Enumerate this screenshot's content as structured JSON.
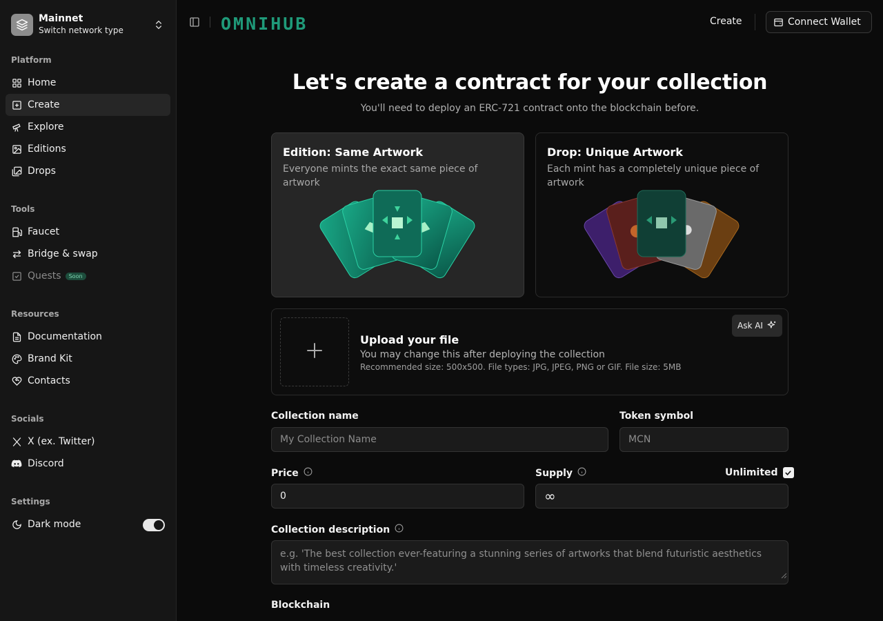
{
  "network": {
    "title": "Mainnet",
    "subtitle": "Switch network type"
  },
  "sidebar": {
    "platform_label": "Platform",
    "platform": [
      {
        "label": "Home",
        "icon": "grid-icon"
      },
      {
        "label": "Create",
        "icon": "plus-square-icon"
      },
      {
        "label": "Explore",
        "icon": "telescope-icon"
      },
      {
        "label": "Editions",
        "icon": "image-icon"
      },
      {
        "label": "Drops",
        "icon": "images-icon"
      }
    ],
    "tools_label": "Tools",
    "tools": [
      {
        "label": "Faucet",
        "icon": "fuel-icon"
      },
      {
        "label": "Bridge & swap",
        "icon": "arrows-icon"
      },
      {
        "label": "Quests",
        "icon": "check-square-icon",
        "badge": "Soon"
      }
    ],
    "resources_label": "Resources",
    "resources": [
      {
        "label": "Documentation",
        "icon": "file-icon"
      },
      {
        "label": "Brand Kit",
        "icon": "palette-icon"
      },
      {
        "label": "Contacts",
        "icon": "heart-handshake-icon"
      }
    ],
    "socials_label": "Socials",
    "socials": [
      {
        "label": "X (ex. Twitter)",
        "icon": "x-logo-icon"
      },
      {
        "label": "Discord",
        "icon": "discord-icon"
      }
    ],
    "settings_label": "Settings",
    "dark_mode_label": "Dark mode"
  },
  "header": {
    "brand": "OMNIHUB",
    "create_label": "Create",
    "wallet_label": "Connect Wallet"
  },
  "main": {
    "title": "Let's create a contract for your collection",
    "subtitle": "You'll need to deploy an ERC-721 contract onto the blockchain before.",
    "cards": [
      {
        "title": "Edition: Same Artwork",
        "desc": "Everyone mints the exact same piece of artwork"
      },
      {
        "title": "Drop: Unique Artwork",
        "desc": "Each mint has a completely unique piece of artwork"
      }
    ],
    "upload": {
      "title": "Upload your file",
      "subtitle": "You may change this after deploying the collection",
      "recommend": "Recommended size: 500x500. File types: JPG, JPEG, PNG or GIF. File size: 5MB",
      "ask_ai": "Ask AI"
    },
    "form": {
      "name_label": "Collection name",
      "name_placeholder": "My Collection Name",
      "symbol_label": "Token symbol",
      "symbol_placeholder": "MCN",
      "price_label": "Price",
      "price_value": "0",
      "supply_label": "Supply",
      "unlimited_label": "Unlimited",
      "supply_value": "∞",
      "desc_label": "Collection description",
      "desc_placeholder": "e.g. 'The best collection ever-featuring a stunning series of artworks that blend futuristic aesthetics with timeless creativity.'",
      "blockchain_label": "Blockchain"
    }
  },
  "colors": {
    "accent": "#1f9a79",
    "background": "#0b0b0b",
    "sidebar": "#161616"
  }
}
